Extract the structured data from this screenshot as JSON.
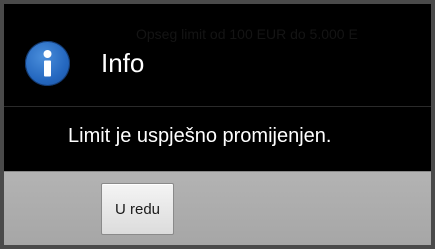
{
  "background": {
    "text": "Opseg limit od 100 EUR do 5.000 E"
  },
  "dialog": {
    "icon": "info-icon",
    "title": "Info",
    "message": "Limit je uspješno promijenjen.",
    "ok_label": "U redu"
  },
  "colors": {
    "icon_blue": "#2467bf",
    "dialog_bg": "#000000",
    "button_bar": "#adadad"
  }
}
